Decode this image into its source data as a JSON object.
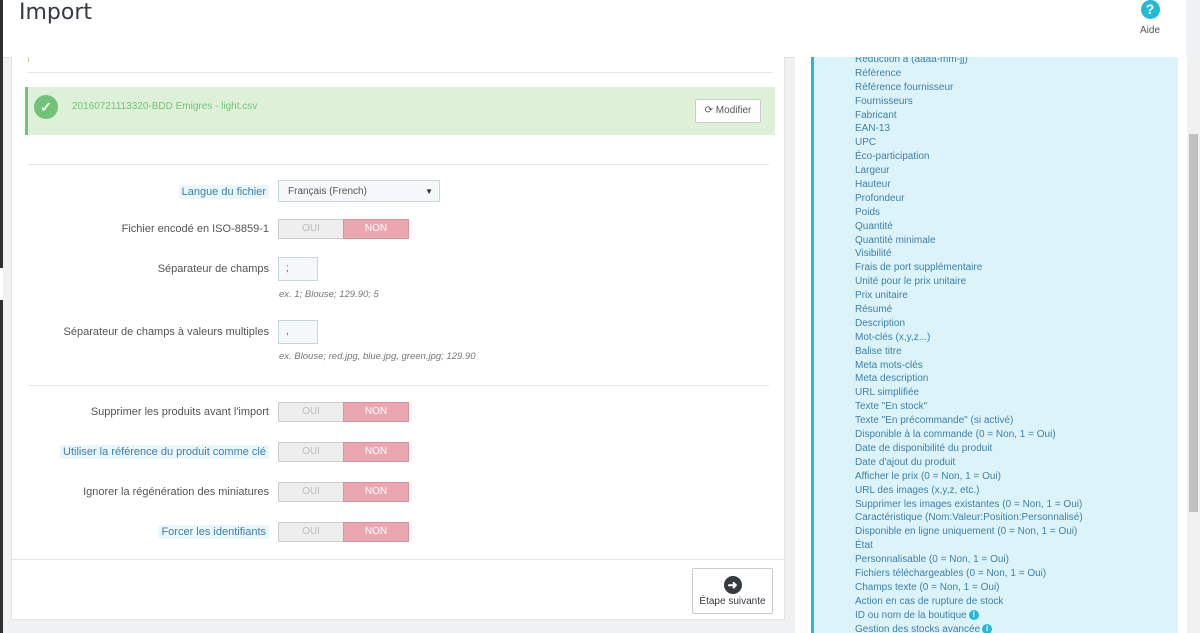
{
  "header": {
    "title": "Import",
    "help_label": "Aide"
  },
  "file": {
    "name": "20160721113320-BDD Emigres - light.csv",
    "modify_label": "Modifier"
  },
  "form": {
    "language": {
      "label": "Langue du fichier",
      "value": "Français (French)"
    },
    "iso": {
      "label": "Fichier encodé en ISO-8859-1"
    },
    "separator": {
      "label": "Séparateur de champs",
      "value": ";",
      "hint": "ex. 1; Blouse; 129.90; 5"
    },
    "multi_separator": {
      "label": "Séparateur de champs à valeurs multiples",
      "value": ",",
      "hint": "ex. Blouse; red.jpg, blue.jpg, green.jpg; 129.90"
    },
    "delete_products": {
      "label": "Supprimer les produits avant l'import"
    },
    "use_reference": {
      "label": "Utiliser la référence du produit comme clé"
    },
    "skip_thumbnails": {
      "label": "Ignorer la régénération des miniatures"
    },
    "force_ids": {
      "label": "Forcer les identifiants"
    },
    "toggle": {
      "yes": "OUI",
      "no": "NON"
    }
  },
  "next_button": "Étape suivante",
  "fields": [
    "Réduction à (aaaa-mm-jj)",
    "Référence",
    "Référence fournisseur",
    "Fournisseurs",
    "Fabricant",
    "EAN-13",
    "UPC",
    "Éco-participation",
    "Largeur",
    "Hauteur",
    "Profondeur",
    "Poids",
    "Quantité",
    "Quantité minimale",
    "Visibilité",
    "Frais de port supplémentaire",
    "Unité pour le prix unitaire",
    "Prix unitaire",
    "Résumé",
    "Description",
    "Mot-clés (x,y,z...)",
    "Balise titre",
    "Meta mots-clés",
    "Meta description",
    "URL simplifiée",
    "Texte \"En stock\"",
    "Texte \"En précommande\" (si activé)",
    "Disponible à la commande (0 = Non, 1 = Oui)",
    "Date de disponibilité du produit",
    "Date d'ajout du produit",
    "Afficher le prix (0 = Non, 1 = Oui)",
    "URL des images (x,y,z, etc.)",
    "Supprimer les images existantes (0 = Non, 1 = Oui)",
    "Caractéristique (Nom:Valeur:Position:Personnalisé)",
    "Disponible en ligne uniquement (0 = Non, 1 = Oui)",
    "État",
    "Personnalisable (0 = Non, 1 = Oui)",
    "Fichiers téléchargeables (0 = Non, 1 = Oui)",
    "Champs texte (0 = Non, 1 = Oui)",
    "Action en cas de rupture de stock",
    "ID ou nom de la boutique",
    "Gestion des stocks avancée"
  ],
  "fields_with_info": [
    40,
    41
  ]
}
